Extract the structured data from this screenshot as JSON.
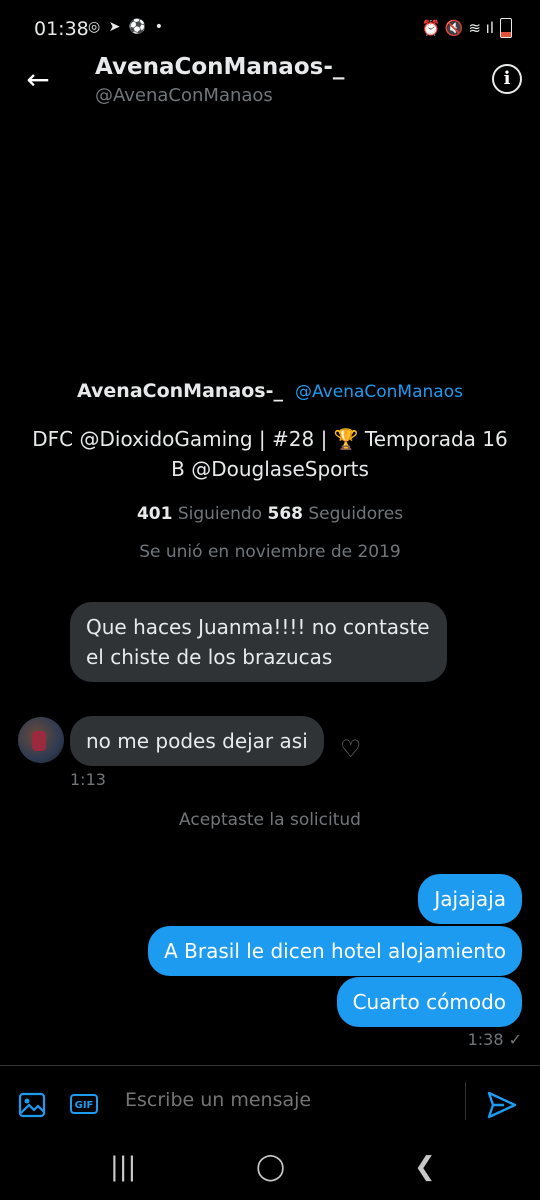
{
  "status_bar": {
    "time": "01:38",
    "left_icons": "◎ ➤ ⚽ •",
    "right_icons": "⏰ 🔇 ≋ ıl"
  },
  "header": {
    "name": "AvenaConManaos-_",
    "handle": "@AvenaConManaos"
  },
  "profile": {
    "name": "AvenaConManaos-_",
    "handle": "@AvenaConManaos",
    "bio": "DFC @DioxidoGaming | #28 | 🏆 Temporada 16 B @DouglaseSports",
    "following_count": "401",
    "following_label": "Siguiendo",
    "followers_count": "568",
    "followers_label": "Seguidores",
    "joined": "Se unió en noviembre de 2019"
  },
  "messages_in": [
    {
      "text": "Que haces Juanma!!!! no contaste el chiste de los brazucas"
    },
    {
      "text": "no me podes dejar asi"
    }
  ],
  "time_in": "1:13",
  "system_message": "Aceptaste la solicitud",
  "messages_out": [
    {
      "text": "Jajajaja"
    },
    {
      "text": "A Brasil le dicen hotel alojamiento"
    },
    {
      "text": "Cuarto cómodo"
    }
  ],
  "time_out": "1:38 ✓",
  "composer": {
    "placeholder": "Escribe un mensaje",
    "gif_label": "GIF"
  },
  "nav": {
    "recents": "|||",
    "home": "◯",
    "back": "❮"
  },
  "colors": {
    "accent": "#1d9bf0",
    "bubble_in": "#2f3336",
    "background": "#000000"
  }
}
